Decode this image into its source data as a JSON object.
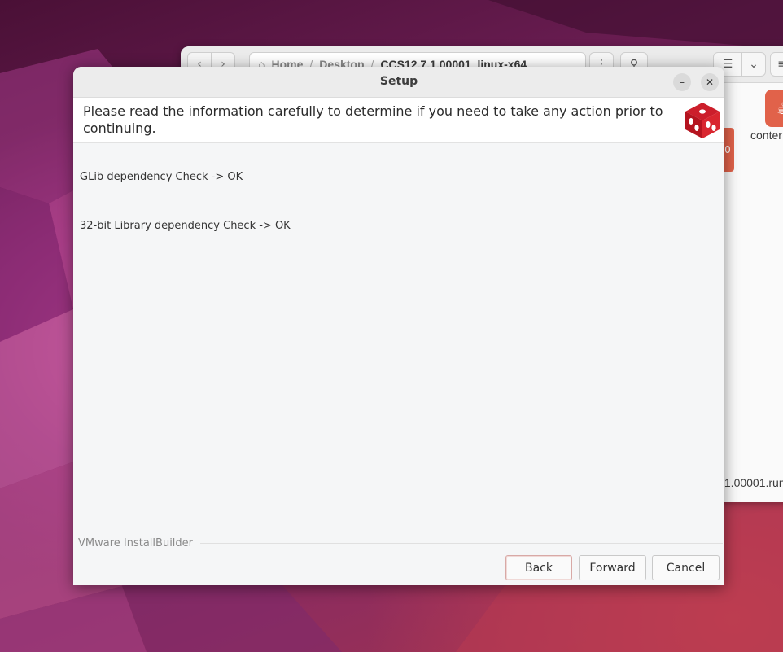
{
  "file_manager": {
    "breadcrumb": {
      "home": "Home",
      "desktop": "Desktop",
      "current": "CCS12.7.1.00001_linux-x64"
    },
    "file_label": "conter",
    "orange_tab_text": "0",
    "run_file_label": ".1.00001.run"
  },
  "dialog": {
    "title": "Setup",
    "minimize_glyph": "–",
    "close_glyph": "✕",
    "header_text": "Please read the information carefully to determine if you need to take any action prior to continuing.",
    "lines": [
      "GLib dependency Check -> OK",
      "32-bit Library dependency Check -> OK"
    ],
    "brand": "VMware InstallBuilder",
    "buttons": {
      "back": "Back",
      "forward": "Forward",
      "cancel": "Cancel"
    },
    "logo_color": "#cc1e2b"
  }
}
